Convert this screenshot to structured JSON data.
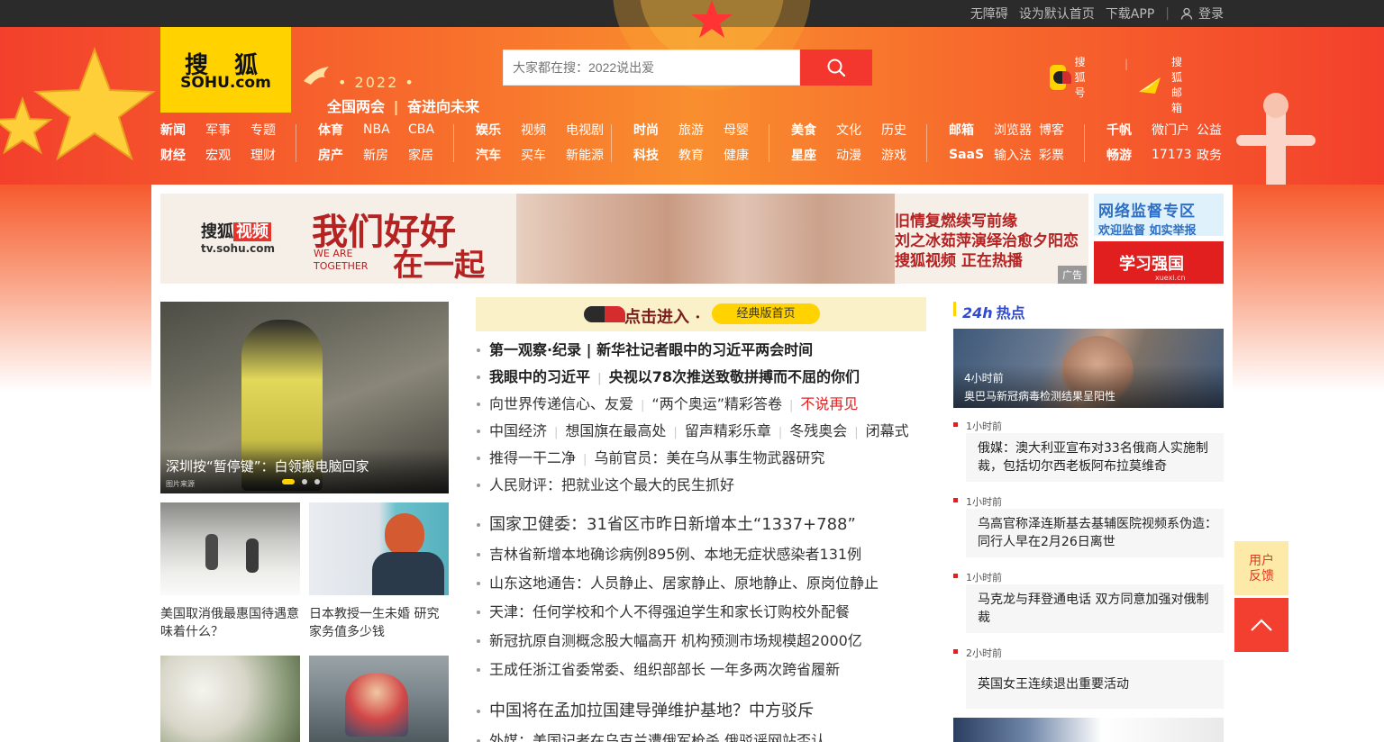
{
  "topbar": {
    "links": [
      "无障碍",
      "设为默认首页",
      "下载APP"
    ],
    "login": "登录"
  },
  "logo": {
    "cn": "搜 狐",
    "en": "SOHU.com"
  },
  "slogan": {
    "year": "• 2022 •",
    "text_a": "全国两会",
    "text_b": "奋进向未来"
  },
  "search": {
    "placeholder": "大家都在搜：2022说出爱"
  },
  "badges": [
    {
      "label": "搜狐号"
    },
    {
      "label": "搜狐邮箱"
    }
  ],
  "nav": [
    {
      "rows": [
        [
          "新闻",
          "军事",
          "专题"
        ],
        [
          "财经",
          "宏观",
          "理财"
        ]
      ]
    },
    {
      "rows": [
        [
          "体育",
          "NBA",
          "CBA"
        ],
        [
          "房产",
          "新房",
          "家居"
        ]
      ]
    },
    {
      "rows": [
        [
          "娱乐",
          "视频",
          "电视剧"
        ],
        [
          "汽车",
          "买车",
          "新能源"
        ]
      ]
    },
    {
      "rows": [
        [
          "时尚",
          "旅游",
          "母婴"
        ],
        [
          "科技",
          "教育",
          "健康"
        ]
      ]
    },
    {
      "rows": [
        [
          "美食",
          "文化",
          "历史"
        ],
        [
          "星座",
          "动漫",
          "游戏"
        ]
      ]
    },
    {
      "rows": [
        [
          "邮箱",
          "浏览器",
          "博客"
        ],
        [
          "SaaS",
          "输入法",
          "彩票"
        ]
      ]
    },
    {
      "rows": [
        [
          "千帆",
          "微门户",
          "公益"
        ],
        [
          "畅游",
          "17173",
          "政务"
        ]
      ]
    }
  ],
  "ad": {
    "brand": "搜狐",
    "brand_tag": "视频",
    "brand_url": "tv.sohu.com",
    "big_a": "我们好好",
    "we_are": "WE ARE",
    "together": "TOGETHER",
    "big_b": "在一起",
    "lines": [
      "旧情复燃续写前缘",
      "刘之冰茹萍演绎治愈夕阳恋",
      "搜狐视频 正在热播"
    ],
    "tag": "广告"
  },
  "side_ads": {
    "a_title": "网络监督专区",
    "a_sub": "欢迎监督 如实举报",
    "b_title": "学习强国",
    "b_sub": "xuexi.cn"
  },
  "hero": {
    "title": "深圳按“暂停键”：白领搬电脑回家",
    "source": "图片来源"
  },
  "thumbs": [
    {
      "caption": "美国取消俄最惠国待遇意味着什么？"
    },
    {
      "caption": "日本教授一生未婚 研究家务值多少钱"
    },
    {
      "caption": ""
    },
    {
      "caption": ""
    }
  ],
  "banner": {
    "title": "点击进入 ·",
    "pill": "经典版首页"
  },
  "news": [
    {
      "parts": [
        "第一观察·纪录 | 新华社记者眼中的习近平两会时间"
      ]
    },
    {
      "parts": [
        "我眼中的习近平",
        "央视以78次推送致敬拼搏而不屈的你们"
      ]
    },
    {
      "parts": [
        "向世界传递信心、友爱",
        "“两个奥运”精彩答卷"
      ],
      "red": "不说再见"
    },
    {
      "parts": [
        "中国经济",
        "想国旗在最高处",
        "留声精彩乐章",
        "冬残奥会",
        "闭幕式"
      ]
    },
    {
      "parts": [
        "推得一干二净",
        "乌前官员：美在乌从事生物武器研究"
      ]
    },
    {
      "parts": [
        "人民财评：把就业这个最大的民生抓好"
      ]
    },
    {
      "parts": [
        "国家卫健委：31省区市昨日新增本土“1337+788”"
      ]
    },
    {
      "parts": [
        "吉林省新增本地确诊病例895例、本地无症状感染者131例"
      ]
    },
    {
      "parts": [
        "山东这地通告：人员静止、居家静止、原地静止、原岗位静止"
      ]
    },
    {
      "parts": [
        "天津：任何学校和个人不得强迫学生和家长订购校外配餐"
      ]
    },
    {
      "parts": [
        "新冠抗原自测概念股大幅高开 机构预测市场规模超2000亿"
      ]
    },
    {
      "parts": [
        "王成任浙江省委常委、组织部部长 一年多两次跨省履新"
      ]
    },
    {
      "parts": [
        "中国将在孟加拉国建导弹维护基地？中方驳斥"
      ]
    },
    {
      "parts": [
        "外媒：美国记者在乌克兰遭俄军枪杀 俄驳谣网站否认"
      ]
    }
  ],
  "hot": {
    "title": "24h",
    "title_b": "热点",
    "featured": {
      "time": "4小时前",
      "title": "奥巴马新冠病毒检测结果呈阳性"
    },
    "items": [
      {
        "time": "1小时前",
        "title": "俄媒：澳大利亚宣布对33名俄商人实施制裁，包括切尔西老板阿布拉莫维奇"
      },
      {
        "time": "1小时前",
        "title": "乌高官称泽连斯基去基辅医院视频系伪造：同行人早在2月26日离世"
      },
      {
        "time": "1小时前",
        "title": "马克龙与拜登通电话 双方同意加强对俄制裁"
      },
      {
        "time": "2小时前",
        "title": "英国女王连续退出重要活动"
      }
    ]
  },
  "feedback": {
    "line1": "用户",
    "line2": "反馈"
  },
  "colors": {
    "brand_yellow": "#ffd200",
    "header_red": "#f3402c",
    "search_red": "#f3362e",
    "alert_red": "#e02020"
  }
}
